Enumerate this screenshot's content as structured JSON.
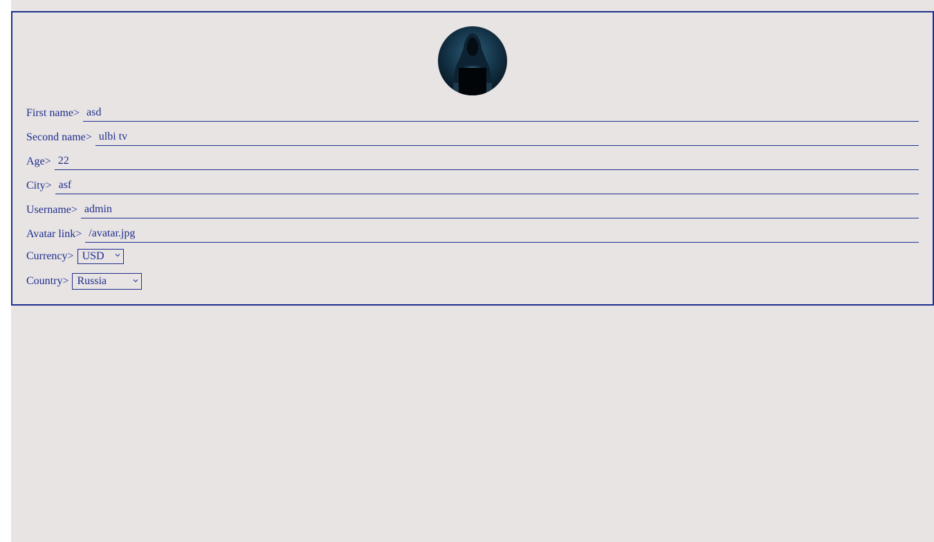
{
  "colors": {
    "accent": "#1f2e8c",
    "background": "#e8e4e4"
  },
  "profile": {
    "avatar_icon": "hooded-hacker-avatar",
    "fields": [
      {
        "label": "First name>",
        "value": "asd"
      },
      {
        "label": "Second name>",
        "value": "ulbi tv"
      },
      {
        "label": "Age>",
        "value": "22"
      },
      {
        "label": "City>",
        "value": "asf"
      },
      {
        "label": "Username>",
        "value": "admin"
      },
      {
        "label": "Avatar link>",
        "value": "/avatar.jpg"
      }
    ],
    "currency": {
      "label": "Currency>",
      "selected": "USD"
    },
    "country": {
      "label": "Country>",
      "selected": "Russia"
    }
  }
}
